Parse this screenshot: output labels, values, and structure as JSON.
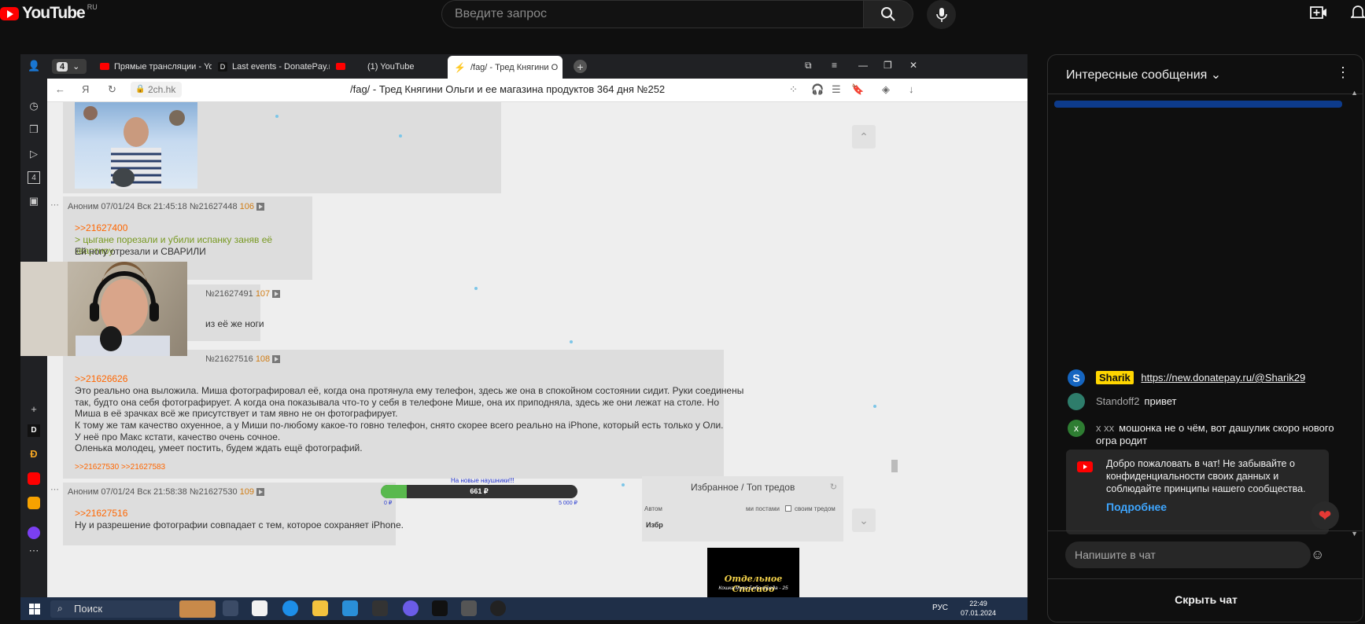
{
  "youtube": {
    "logo_text": "YouTube",
    "region": "RU",
    "search_placeholder": "Введите запрос"
  },
  "browser": {
    "tab_count": "4",
    "tabs": [
      {
        "label": "Прямые трансляции - You",
        "icon": "youtube-icon"
      },
      {
        "label": "Last events - DonatePay.ru",
        "icon": "donatepay-icon"
      },
      {
        "label": "(1) YouTube",
        "icon": "youtube-icon"
      },
      {
        "label": "/fag/ - Тред Княгини О",
        "icon": "bolt-icon"
      }
    ],
    "url": "2ch.hk",
    "page_title": "/fag/ - Тред Княгини Ольги и ее магазина продуктов 364 дня №252"
  },
  "posts": [
    {
      "head": "Аноним 07/01/24 Вск 21:45:18 №21627448",
      "count": "106",
      "reply": ">>21627400",
      "greentext": "> цыгане порезали и убили испанку заняв её квартиру",
      "text": "Ей ногу отрезали и СВАРИЛИ"
    },
    {
      "head": "№21627491",
      "count": "107",
      "text": "из её же ноги"
    },
    {
      "head": "№21627516",
      "count": "108",
      "reply": ">>21626626",
      "lines": [
        "Это реально она выложила. Миша фотографировал её, когда она протянула ему телефон, здесь же она в спокойном состоянии сидит. Руки соединены",
        "так, будто она себя фотографирует. А когда она показывала что-то у себя в телефоне Мише, она их приподняла, здесь же они лежат на столе. Но",
        "Миша в её зрачках всё же присутствует и там явно не он фотографирует.",
        "К тому же там качество охуенное, а у Миши по-любому какое-то говно телефон, снято скорее всего реально на iPhone, который есть только у Оли.",
        "У неё про Макс кстати, качество очень сочное.",
        "Оленька молодец, умеет постить, будем ждать ещё фотографий."
      ],
      "backlinks": ">>21627530 >>21627583"
    },
    {
      "head": "Аноним 07/01/24 Вск 21:58:38 №21627530",
      "count": "109",
      "reply": ">>21627516",
      "text": "Ну и разрешение фотографии совпадает с тем, которое сохраняет iPhone."
    }
  ],
  "donation_widget": {
    "title": "На новые наушники!!!",
    "current": "661 ₽",
    "min": "0 ₽",
    "max": "5 000 ₽",
    "progress": 0.132
  },
  "favorites": {
    "title": "Избранное / Топ тредов",
    "auto_label": "Автом",
    "posts_label": "ми постами",
    "own_label": "своим тредом",
    "fav_short": "Избр"
  },
  "thanks_overlay": {
    "title": "Отдельное Спасибо",
    "subtitle": "Кошка Муся Баба треда - 25"
  },
  "taskbar": {
    "search": "Поиск",
    "lang": "РУС",
    "time": "22:49",
    "date": "07.01.2024"
  },
  "chat": {
    "title": "Интересные сообщения",
    "messages": [
      {
        "author": "Sharik",
        "text": "https://new.donatepay.ru/@Sharik29",
        "avatar_color": "#1565c0",
        "badge": true
      },
      {
        "author": "Standoff2",
        "text": "привет",
        "avatar_color": "#2e7d6b",
        "badge": false
      },
      {
        "author": "x xx",
        "text": "мошонка не о чём, вот дашулик скоро нового огра родит",
        "avatar_color": "#2e7d32",
        "avatar_letter": "x",
        "badge": false
      }
    ],
    "notice": "Добро пожаловать в чат! Не забывайте о конфиденциальности своих данных и соблюдайте принципы нашего сообщества.",
    "notice_link": "Подробнее",
    "input_placeholder": "Напишите в чат",
    "hide_label": "Скрыть чат"
  }
}
